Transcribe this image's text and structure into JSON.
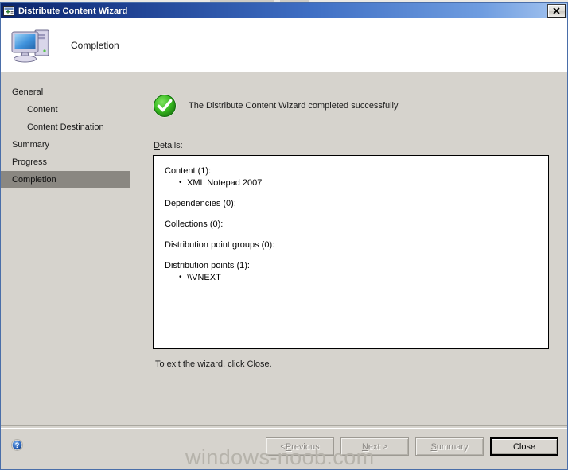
{
  "window": {
    "title": "Distribute Content Wizard",
    "title_icon": "wizard-window-icon",
    "close_label": "✕"
  },
  "header": {
    "title": "Completion",
    "icon": "computer-monitor-icon"
  },
  "sidebar": {
    "items": [
      {
        "label": "General",
        "level": 0,
        "selected": false
      },
      {
        "label": "Content",
        "level": 1,
        "selected": false
      },
      {
        "label": "Content Destination",
        "level": 1,
        "selected": false
      },
      {
        "label": "Summary",
        "level": 0,
        "selected": false
      },
      {
        "label": "Progress",
        "level": 0,
        "selected": false
      },
      {
        "label": "Completion",
        "level": 0,
        "selected": true
      }
    ]
  },
  "main": {
    "status_icon": "green-check-circle-icon",
    "status_text": "The Distribute Content Wizard completed successfully",
    "details_label_accel": "D",
    "details_label_rest": "etails:",
    "details": [
      {
        "heading": "Content (1):",
        "items": [
          "XML Notepad 2007"
        ]
      },
      {
        "heading": "Dependencies (0):",
        "items": []
      },
      {
        "heading": "Collections (0):",
        "items": []
      },
      {
        "heading": "Distribution point groups (0):",
        "items": []
      },
      {
        "heading": "Distribution points (1):",
        "items": [
          "\\\\VNEXT"
        ]
      }
    ],
    "exit_hint": "To exit the wizard, click Close."
  },
  "footer": {
    "help_icon": "help-question-icon",
    "buttons": [
      {
        "name": "previous",
        "pre": "< ",
        "accel": "P",
        "post": "revious",
        "enabled": false
      },
      {
        "name": "next",
        "pre": "",
        "accel": "N",
        "post": "ext >",
        "enabled": false
      },
      {
        "name": "summary",
        "pre": "",
        "accel": "S",
        "post": "ummary",
        "enabled": false
      },
      {
        "name": "close",
        "pre": "",
        "accel": "",
        "post": "Close",
        "enabled": true
      }
    ]
  },
  "watermark": {
    "text": "windows-noob.com"
  },
  "colors": {
    "dialog_face": "#d6d3cd",
    "titlebar_start": "#0a246a",
    "titlebar_end": "#a7c6f0",
    "selected_row": "#8a8781",
    "success_green": "#3aa523",
    "help_blue": "#2a62b8"
  }
}
